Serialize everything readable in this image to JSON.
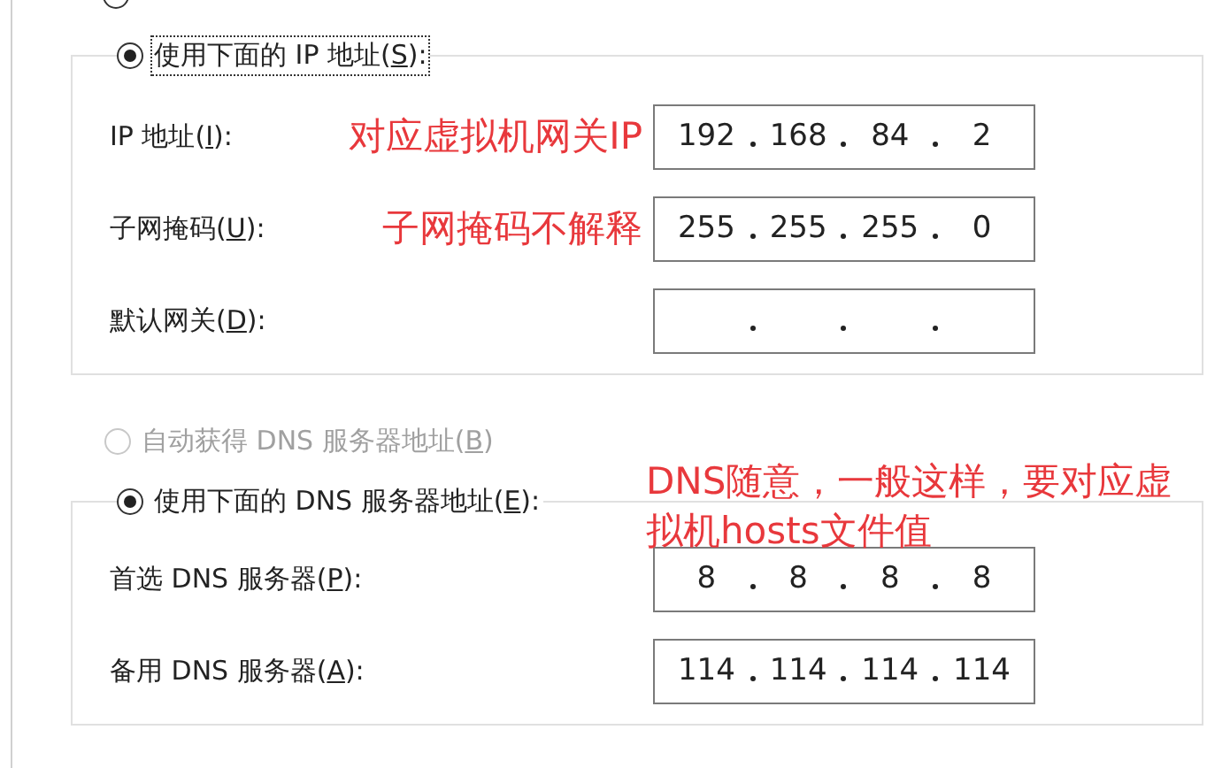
{
  "radio_above": {
    "selected": false,
    "disabled": false
  },
  "ip_group": {
    "radio": {
      "label": "使用下面的 IP 地址(",
      "access_key": "S",
      "label_end": "):",
      "selected": true,
      "disabled": false,
      "focused": true
    },
    "rows": [
      {
        "label": "IP 地址(",
        "access_key": "I",
        "label_end": "):",
        "note": "对应虚拟机网关IP",
        "octets": [
          "192",
          "168",
          "84",
          "2"
        ]
      },
      {
        "label": "子网掩码(",
        "access_key": "U",
        "label_end": "):",
        "note": "子网掩码不解释",
        "octets": [
          "255",
          "255",
          "255",
          "0"
        ]
      },
      {
        "label": "默认网关(",
        "access_key": "D",
        "label_end": "):"
      }
    ]
  },
  "dns_auto_radio": {
    "label": "自动获得 DNS 服务器地址(",
    "access_key": "B",
    "label_end": ")",
    "selected": false,
    "disabled": true
  },
  "dns_note": "DNS随意，一般这样，要对应虚拟机hosts文件值",
  "dns_group": {
    "radio": {
      "label": "使用下面的 DNS 服务器地址(",
      "access_key": "E",
      "label_end": "):",
      "selected": true,
      "disabled": false,
      "focused": false
    },
    "rows": [
      {
        "label": "首选 DNS 服务器(",
        "access_key": "P",
        "label_end": "):",
        "octets": [
          "8",
          "8",
          "8",
          "8"
        ]
      },
      {
        "label": "备用 DNS 服务器(",
        "access_key": "A",
        "label_end": "):",
        "octets": [
          "114",
          "114",
          "114",
          "114"
        ]
      }
    ]
  }
}
